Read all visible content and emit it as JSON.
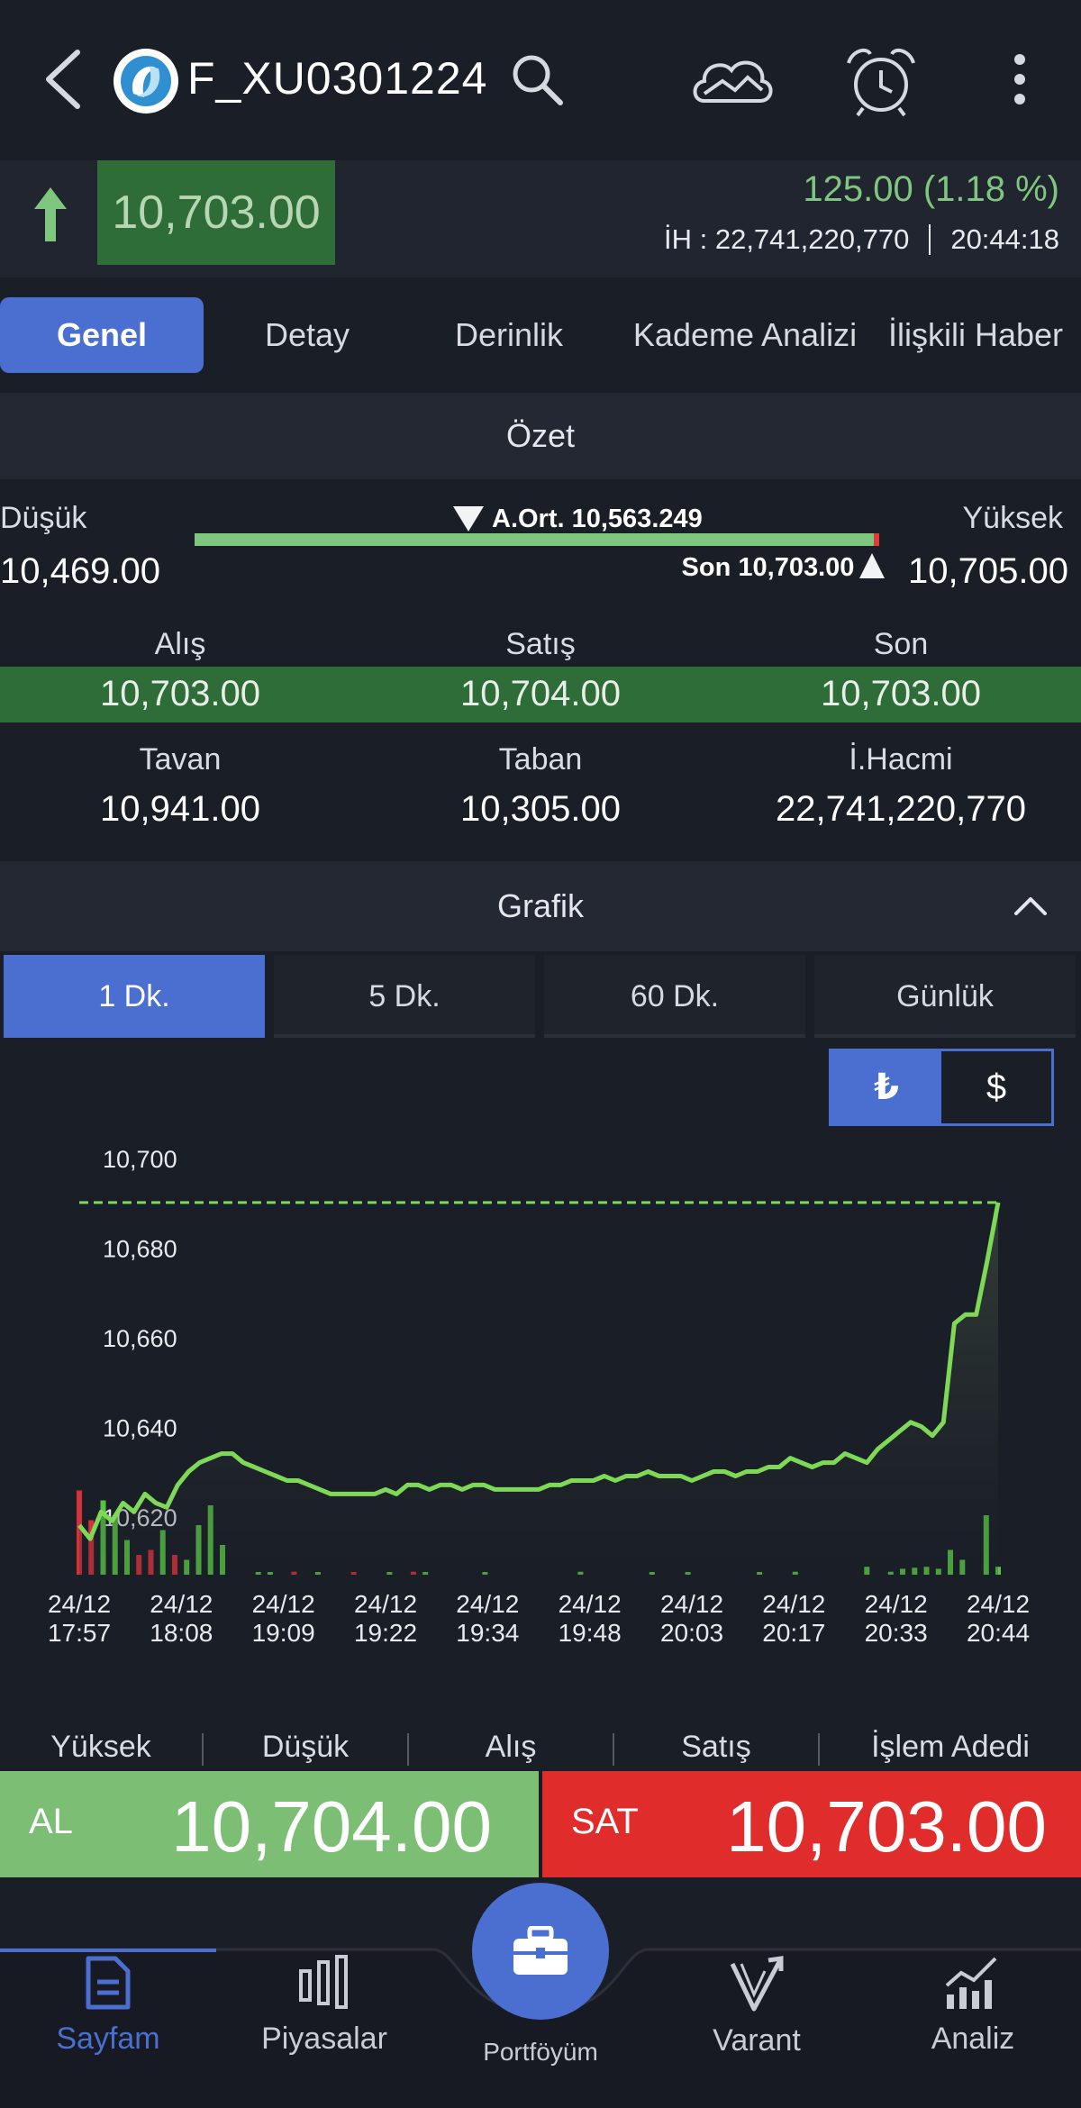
{
  "header": {
    "symbol": "F_XU0301224",
    "icons": [
      "back-chevron-icon",
      "logo-icon",
      "search-icon",
      "cloud-chart-icon",
      "alarm-clock-icon",
      "more-vertical-icon"
    ]
  },
  "price": {
    "last": "10,703.00",
    "change": "125.00 (1.18 %)",
    "volume_line": "İH : 22,741,220,770",
    "time": "20:44:18",
    "colors": {
      "up": "#7fc77f",
      "highlight": "#2e6d37"
    }
  },
  "tabs": [
    "Genel",
    "Detay",
    "Derinlik",
    "Kademe Analizi",
    "İlişkili Haber"
  ],
  "summary": {
    "title": "Özet",
    "low_label": "Düşük",
    "low_value": "10,469.00",
    "high_label": "Yüksek",
    "high_value": "10,705.00",
    "avg_text": "A.Ort. 10,563.249",
    "last_text": "Son 10,703.00",
    "range_avg_fraction": 0.4,
    "range_last_fraction": 0.99,
    "bid_label": "Alış",
    "bid_value": "10,703.00",
    "ask_label": "Satış",
    "ask_value": "10,704.00",
    "son_label": "Son",
    "son_value": "10,703.00",
    "ceiling_label": "Tavan",
    "ceiling_value": "10,941.00",
    "floor_label": "Taban",
    "floor_value": "10,305.00",
    "volume_label": "İ.Hacmi",
    "volume_value": "22,741,220,770"
  },
  "chart_section": {
    "title": "Grafik",
    "timeframes": [
      "1 Dk.",
      "5 Dk.",
      "60 Dk.",
      "Günlük"
    ],
    "active_timeframe": 0,
    "currency": [
      "₺",
      "$"
    ],
    "active_currency": 0
  },
  "chart_data": {
    "type": "area",
    "y_ticks": [
      "10,700",
      "10,680",
      "10,660",
      "10,640",
      "10,620"
    ],
    "ylim": [
      10612,
      10702
    ],
    "reference_line": 10695,
    "x_labels": [
      [
        "24/12",
        "17:57"
      ],
      [
        "24/12",
        "18:08"
      ],
      [
        "24/12",
        "19:09"
      ],
      [
        "24/12",
        "19:22"
      ],
      [
        "24/12",
        "19:34"
      ],
      [
        "24/12",
        "19:48"
      ],
      [
        "24/12",
        "20:03"
      ],
      [
        "24/12",
        "20:17"
      ],
      [
        "24/12",
        "20:33"
      ],
      [
        "24/12",
        "20:44"
      ]
    ],
    "price_series": [
      10623,
      10620,
      10626,
      10624,
      10628,
      10626,
      10630,
      10628,
      10627,
      10632,
      10635,
      10637,
      10638,
      10639,
      10639,
      10637,
      10636,
      10635,
      10634,
      10633,
      10633,
      10632,
      10631,
      10630,
      10630,
      10630,
      10630,
      10630,
      10631,
      10630,
      10632,
      10632,
      10631,
      10632,
      10632,
      10631,
      10632,
      10632,
      10631,
      10631,
      10631,
      10631,
      10631,
      10632,
      10632,
      10633,
      10633,
      10633,
      10634,
      10633,
      10634,
      10634,
      10635,
      10634,
      10634,
      10634,
      10633,
      10634,
      10635,
      10635,
      10634,
      10635,
      10635,
      10636,
      10636,
      10638,
      10637,
      10636,
      10637,
      10637,
      10639,
      10638,
      10637,
      10640,
      10642,
      10644,
      10646,
      10645,
      10643,
      10646,
      10668,
      10670,
      10670,
      10682,
      10695
    ],
    "volume_series": [
      {
        "v": 0.85,
        "c": "red"
      },
      {
        "v": 0.55,
        "c": "red"
      },
      {
        "v": 0.75,
        "c": "green"
      },
      {
        "v": 0.6,
        "c": "green"
      },
      {
        "v": 0.35,
        "c": "green"
      },
      {
        "v": 0.2,
        "c": "red"
      },
      {
        "v": 0.25,
        "c": "red"
      },
      {
        "v": 0.45,
        "c": "green"
      },
      {
        "v": 0.2,
        "c": "red"
      },
      {
        "v": 0.15,
        "c": "green"
      },
      {
        "v": 0.5,
        "c": "green"
      },
      {
        "v": 0.7,
        "c": "green"
      },
      {
        "v": 0.3,
        "c": "green"
      },
      {
        "v": 0.0,
        "c": "green"
      },
      {
        "v": 0.0,
        "c": "green"
      },
      {
        "v": 0.02,
        "c": "green"
      },
      {
        "v": 0.02,
        "c": "green"
      },
      {
        "v": 0.0,
        "c": "green"
      },
      {
        "v": 0.03,
        "c": "red"
      },
      {
        "v": 0.0,
        "c": "green"
      },
      {
        "v": 0.02,
        "c": "green"
      },
      {
        "v": 0.0,
        "c": "green"
      },
      {
        "v": 0.0,
        "c": "green"
      },
      {
        "v": 0.02,
        "c": "red"
      },
      {
        "v": 0.0,
        "c": "green"
      },
      {
        "v": 0.0,
        "c": "green"
      },
      {
        "v": 0.02,
        "c": "green"
      },
      {
        "v": 0.0,
        "c": "green"
      },
      {
        "v": 0.03,
        "c": "red"
      },
      {
        "v": 0.02,
        "c": "green"
      },
      {
        "v": 0.0,
        "c": "green"
      },
      {
        "v": 0.0,
        "c": "green"
      },
      {
        "v": 0.0,
        "c": "green"
      },
      {
        "v": 0.0,
        "c": "green"
      },
      {
        "v": 0.02,
        "c": "green"
      },
      {
        "v": 0.0,
        "c": "green"
      },
      {
        "v": 0.0,
        "c": "green"
      },
      {
        "v": 0.0,
        "c": "green"
      },
      {
        "v": 0.0,
        "c": "green"
      },
      {
        "v": 0.0,
        "c": "green"
      },
      {
        "v": 0.0,
        "c": "green"
      },
      {
        "v": 0.0,
        "c": "green"
      },
      {
        "v": 0.03,
        "c": "green"
      },
      {
        "v": 0.0,
        "c": "green"
      },
      {
        "v": 0.0,
        "c": "green"
      },
      {
        "v": 0.0,
        "c": "green"
      },
      {
        "v": 0.0,
        "c": "green"
      },
      {
        "v": 0.0,
        "c": "green"
      },
      {
        "v": 0.02,
        "c": "green"
      },
      {
        "v": 0.0,
        "c": "green"
      },
      {
        "v": 0.0,
        "c": "green"
      },
      {
        "v": 0.02,
        "c": "green"
      },
      {
        "v": 0.0,
        "c": "green"
      },
      {
        "v": 0.0,
        "c": "green"
      },
      {
        "v": 0.0,
        "c": "green"
      },
      {
        "v": 0.0,
        "c": "green"
      },
      {
        "v": 0.0,
        "c": "green"
      },
      {
        "v": 0.02,
        "c": "green"
      },
      {
        "v": 0.0,
        "c": "green"
      },
      {
        "v": 0.0,
        "c": "green"
      },
      {
        "v": 0.03,
        "c": "green"
      },
      {
        "v": 0.0,
        "c": "green"
      },
      {
        "v": 0.0,
        "c": "green"
      },
      {
        "v": 0.0,
        "c": "green"
      },
      {
        "v": 0.0,
        "c": "green"
      },
      {
        "v": 0.0,
        "c": "green"
      },
      {
        "v": 0.08,
        "c": "green"
      },
      {
        "v": 0.0,
        "c": "green"
      },
      {
        "v": 0.03,
        "c": "green"
      },
      {
        "v": 0.06,
        "c": "green"
      },
      {
        "v": 0.07,
        "c": "green"
      },
      {
        "v": 0.08,
        "c": "green"
      },
      {
        "v": 0.06,
        "c": "green"
      },
      {
        "v": 0.25,
        "c": "green"
      },
      {
        "v": 0.15,
        "c": "green"
      },
      {
        "v": 0.0,
        "c": "green"
      },
      {
        "v": 0.6,
        "c": "green"
      },
      {
        "v": 0.08,
        "c": "green"
      }
    ],
    "colors": {
      "line": "#7ed957",
      "up_bar": "#57c244",
      "down_bar": "#d4313b"
    }
  },
  "stats_header": [
    "Yüksek",
    "Düşük",
    "Alış",
    "Satış",
    "İşlem Adedi"
  ],
  "trade": {
    "buy_label": "AL",
    "buy_price": "10,704.00",
    "sell_label": "SAT",
    "sell_price": "10,703.00",
    "colors": {
      "buy": "#7cbf74",
      "sell": "#e12c2c"
    }
  },
  "nav": {
    "items": [
      {
        "label": "Sayfam",
        "icon": "document-icon"
      },
      {
        "label": "Piyasalar",
        "icon": "market-bars-icon"
      },
      {
        "label": "Portföyüm",
        "icon": "briefcase-icon"
      },
      {
        "label": "Varant",
        "icon": "warrant-icon"
      },
      {
        "label": "Analiz",
        "icon": "analysis-chart-icon"
      }
    ],
    "active": 0
  }
}
